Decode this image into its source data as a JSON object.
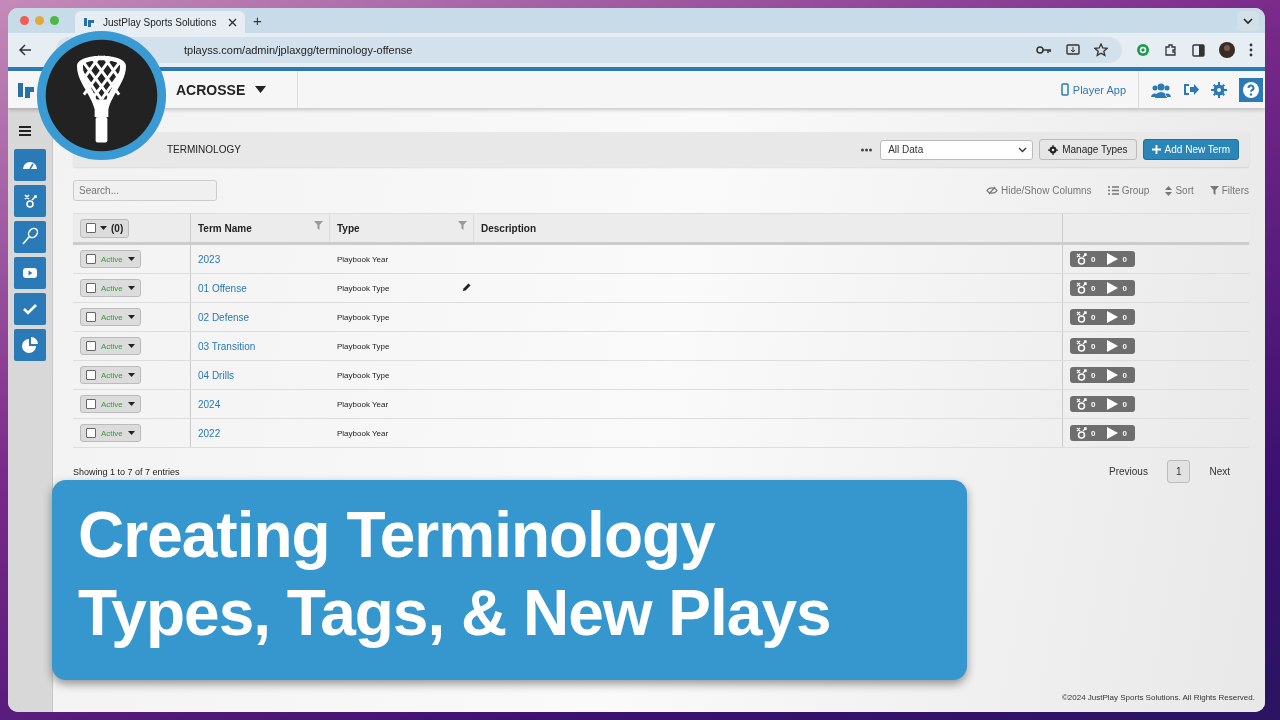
{
  "browser": {
    "tab_title": "JustPlay Sports Solutions",
    "new_tab": "+",
    "address": "tplayss.com/admin/jplaxgg/terminology-offense"
  },
  "header": {
    "sport": "ACROSSE",
    "player_app": "Player App"
  },
  "toolbar": {
    "breadcrumb": "TERMINOLOGY",
    "filter": "All Data",
    "manage": "Manage Types",
    "add": "Add New Term"
  },
  "search": {
    "placeholder": "Search..."
  },
  "table_tools": [
    {
      "kind": "columns",
      "label": "Hide/Show Columns"
    },
    {
      "kind": "group",
      "label": "Group"
    },
    {
      "kind": "sort",
      "label": "Sort"
    },
    {
      "kind": "filters",
      "label": "Filters"
    }
  ],
  "table": {
    "select_all_checked": false,
    "select_count": "(0)",
    "columns": [
      {
        "label": "Term Name",
        "filter": true
      },
      {
        "label": "Type",
        "filter": true
      },
      {
        "label": "Description",
        "filter": false
      }
    ],
    "rows": [
      {
        "status": "Active",
        "checked": false,
        "name": "2023",
        "type": "Playbook Year",
        "hovered": false,
        "tags": "0",
        "plays": "0"
      },
      {
        "status": "Active",
        "checked": false,
        "name": "01 Offense",
        "type": "Playbook Type",
        "hovered": true,
        "tags": "0",
        "plays": "0"
      },
      {
        "status": "Active",
        "checked": false,
        "name": "02 Defense",
        "type": "Playbook Type",
        "hovered": false,
        "tags": "0",
        "plays": "0"
      },
      {
        "status": "Active",
        "checked": false,
        "name": "03 Transition",
        "type": "Playbook Type",
        "hovered": false,
        "tags": "0",
        "plays": "0"
      },
      {
        "status": "Active",
        "checked": false,
        "name": "04 Drills",
        "type": "Playbook Type",
        "hovered": false,
        "tags": "0",
        "plays": "0"
      },
      {
        "status": "Active",
        "checked": false,
        "name": "2024",
        "type": "Playbook Year",
        "hovered": false,
        "tags": "0",
        "plays": "0"
      },
      {
        "status": "Active",
        "checked": false,
        "name": "2022",
        "type": "Playbook Year",
        "hovered": false,
        "tags": "0",
        "plays": "0"
      }
    ]
  },
  "footer": {
    "entries": "Showing 1 to 7 of 7 entries",
    "pagination": [
      {
        "label": "Previous",
        "selected": false
      },
      {
        "label": "1",
        "selected": true
      },
      {
        "label": "Next",
        "selected": false
      }
    ],
    "copyright": "©2024 JustPlay Sports Solutions. All Rights Reserved."
  },
  "banner": {
    "lines": [
      "Creating Terminology",
      "Types, Tags, & New Plays"
    ]
  }
}
